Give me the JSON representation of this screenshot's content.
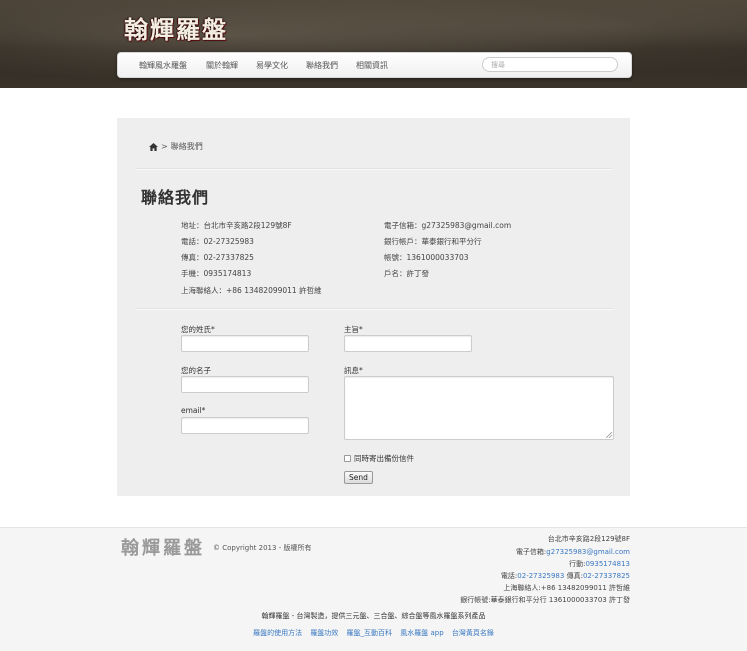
{
  "brand": {
    "logo_text": "翰輝羅盤"
  },
  "nav": {
    "items": [
      "翰輝風水羅盤",
      "關於翰輝",
      "易學文化",
      "聯絡我們",
      "相關資訊"
    ],
    "search_placeholder": "搜尋"
  },
  "breadcrumb": {
    "current": "聯絡我們",
    "separator": ">"
  },
  "page": {
    "title": "聯絡我們"
  },
  "contact": {
    "left": [
      "地址：台北市辛亥路2段129號8F",
      "電話：02-27325983",
      "傳真：02-27337825",
      "手機：0935174813",
      "上海聯絡人：+86 13482099011 許哲維"
    ],
    "right": [
      "電子信箱：g27325983@gmail.com",
      "銀行帳戶：華泰銀行和平分行",
      "帳號：1361000033703",
      "戶名：許丁發"
    ]
  },
  "form": {
    "surname_label": "您的姓氏*",
    "name_label": "您的名子",
    "email_label": "email*",
    "subject_label": "主旨*",
    "message_label": "訊息*",
    "copy_label": "同時寄出備份信件",
    "send_label": "Send"
  },
  "footer": {
    "logo_text": "翰輝羅盤",
    "copyright": "© Copyright 2013 - 版權所有",
    "address": "台北市辛亥路2段129號8F",
    "email_prefix": "電子信箱:",
    "email": "g27325983@gmail.com",
    "mobile_prefix": "行動:",
    "mobile": "0935174813",
    "phone_prefix": "電話:",
    "phone": "02-27325983",
    "fax_prefix": " 傳真:",
    "fax": "02-27337825",
    "shanghai": "上海聯絡人:+86 13482099011 許哲維",
    "bank": "銀行帳號:華泰銀行和平分行 1361000033703 許丁發",
    "tagline": "翰輝羅盤 - 台灣製造，提供三元盤、三合盤、綜合盤等風水羅盤系列產品",
    "links": [
      "羅盤的使用方法",
      "羅盤功效",
      "羅盤_互動百科",
      "風水羅盤 app",
      "台灣黃頁名錄"
    ]
  },
  "colors": {
    "link": "#3a78c2",
    "panel": "#eeeeee",
    "header_dark": "#2c261f"
  }
}
